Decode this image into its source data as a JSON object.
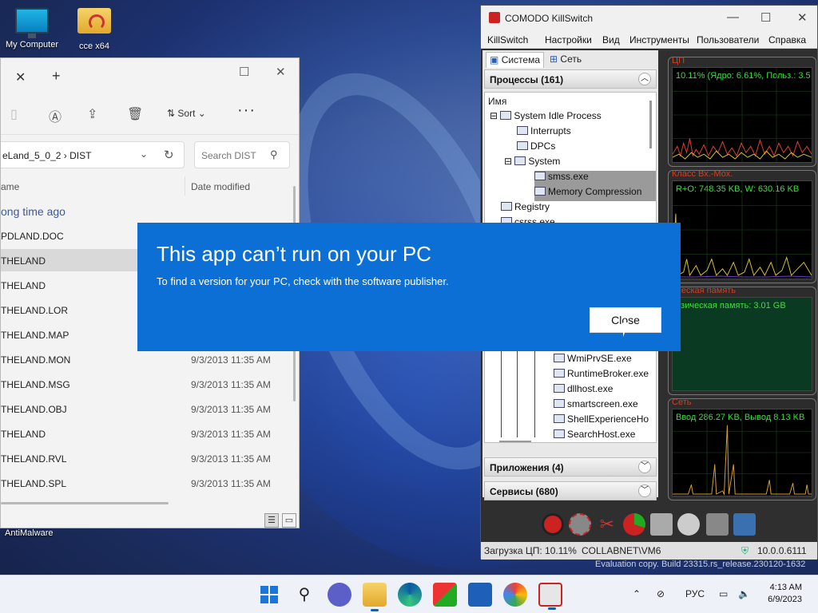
{
  "desktop": {
    "icons": [
      {
        "label": "My Computer",
        "icon": "computer-icon"
      },
      {
        "label": "cce x64",
        "icon": "folder-icon"
      }
    ],
    "antimalware_label": "AntiMalware"
  },
  "explorer": {
    "tab_add": "+",
    "sort_label": "Sort",
    "more": "···",
    "breadcrumb": "eLand_5_0_2  ›  DIST",
    "search_placeholder": "Search DIST",
    "columns": {
      "name": "ame",
      "date": "Date modified"
    },
    "group": "ong time ago",
    "files": [
      {
        "name": "PDLAND.DOC",
        "date": ""
      },
      {
        "name": "THELAND",
        "date": "",
        "selected": true
      },
      {
        "name": "THELAND",
        "date": ""
      },
      {
        "name": "THELAND.LOR",
        "date": ""
      },
      {
        "name": "THELAND.MAP",
        "date": ""
      },
      {
        "name": "THELAND.MON",
        "date": "9/3/2013 11:35 AM"
      },
      {
        "name": "THELAND.MSG",
        "date": "9/3/2013 11:35 AM"
      },
      {
        "name": "THELAND.OBJ",
        "date": "9/3/2013 11:35 AM"
      },
      {
        "name": "THELAND",
        "date": "9/3/2013 11:35 AM"
      },
      {
        "name": "THELAND.RVL",
        "date": "9/3/2013 11:35 AM"
      },
      {
        "name": "THELAND.SPL",
        "date": "9/3/2013 11:35 AM"
      }
    ]
  },
  "killswitch": {
    "title": "COMODO KillSwitch",
    "menu": [
      "KillSwitch",
      "Настройки",
      "Вид",
      "Инструменты",
      "Пользователи",
      "Справка"
    ],
    "tabs": [
      "Система",
      "Сеть"
    ],
    "processes_header": "Процессы (161)",
    "name_col": "Имя",
    "tree": [
      "System Idle Process",
      "Interrupts",
      "DPCs",
      "System",
      "smss.exe",
      "Memory Compression",
      "Registry",
      "csrss.exe",
      "WmiPrvSE.exe",
      "RuntimeBroker.exe",
      "dllhost.exe",
      "smartscreen.exe",
      "ShellExperienceHo",
      "SearchHost.exe"
    ],
    "apps_header": "Приложения (4)",
    "services_header": "Сервисы (680)",
    "graphs": {
      "cpu_label": "ЦП",
      "cpu_value": "10.11% (Ядро: 6.61%, Польз.: 3.5",
      "io_label": "Класс Вх.-Мох.",
      "io_value": "R+O: 748.35 KB, W: 630.16 KB",
      "mem_label": "ическая память",
      "mem_value": "изическая память: 3.01 GB",
      "net_label": "Сеть",
      "net_value": "Ввод 286.27 KB, Вывод 8.13 KB"
    },
    "status": {
      "cpu": "Загрузка ЦП: 10.11%",
      "user": "COLLABNET\\VM6",
      "ip": "10.0.0.6111"
    },
    "colors": {
      "graph_text": "#38e038",
      "graph_label": "#d04020"
    }
  },
  "eval_text": "Evaluation copy. Build 23315.rs_release.230120-1632",
  "dialog": {
    "title": "This app can’t run on your PC",
    "message": "To find a version for your PC, check with the software publisher.",
    "close_label": "Close",
    "color": "#0b6fd6"
  },
  "taskbar": {
    "lang": "РУС",
    "time": "4:13 AM",
    "date": "6/9/2023"
  }
}
